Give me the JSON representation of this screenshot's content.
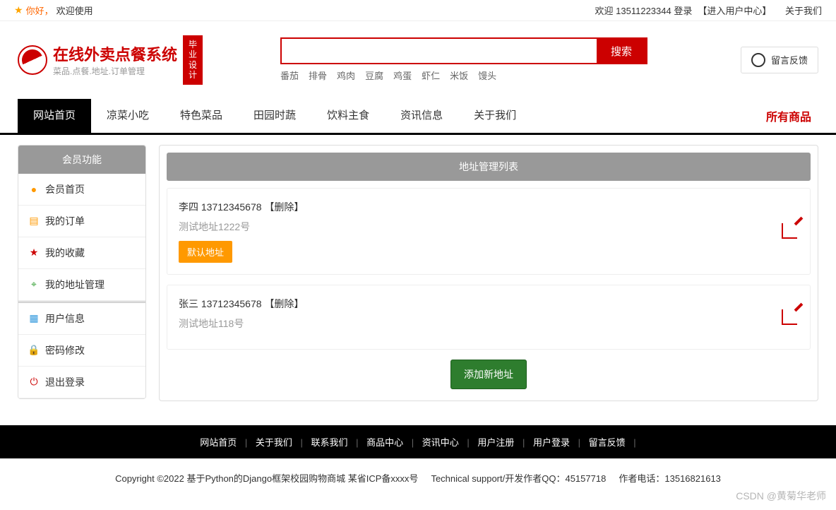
{
  "topbar": {
    "greeting_prefix": "你好，",
    "greeting_text": "欢迎使用",
    "welcome": "欢迎 13511223344 登录 ",
    "user_center": "【进入用户中心】",
    "about": "关于我们"
  },
  "logo": {
    "title": "在线外卖点餐系统",
    "sub": "菜品.点餐.地址.订单管理",
    "badge_line1": "毕业",
    "badge_line2": "设计"
  },
  "search": {
    "button": "搜索",
    "placeholder": "",
    "tags": [
      "番茄",
      "排骨",
      "鸡肉",
      "豆腐",
      "鸡蛋",
      "虾仁",
      "米饭",
      "馒头"
    ]
  },
  "feedback": {
    "label": "留言反馈"
  },
  "nav": {
    "items": [
      "网站首页",
      "凉菜小吃",
      "特色菜品",
      "田园时蔬",
      "饮料主食",
      "资讯信息",
      "关于我们"
    ],
    "all_goods": "所有商品"
  },
  "sidebar": {
    "title": "会员功能",
    "items": [
      {
        "label": "会员首页",
        "icon": "home",
        "cls": "ico-home",
        "glyph": "●"
      },
      {
        "label": "我的订单",
        "icon": "order",
        "cls": "ico-order",
        "glyph": "▤"
      },
      {
        "label": "我的收藏",
        "icon": "star",
        "cls": "ico-star",
        "glyph": "★"
      },
      {
        "label": "我的地址管理",
        "icon": "pin",
        "cls": "ico-pin",
        "glyph": "⌖"
      }
    ],
    "items2": [
      {
        "label": "用户信息",
        "icon": "user",
        "cls": "ico-user",
        "glyph": "▦"
      },
      {
        "label": "密码修改",
        "icon": "lock",
        "cls": "ico-lock",
        "glyph": "🔒"
      },
      {
        "label": "退出登录",
        "icon": "power",
        "cls": "ico-power",
        "glyph": "⏻"
      }
    ]
  },
  "content": {
    "title": "地址管理列表",
    "addresses": [
      {
        "name": "李四",
        "phone": "13712345678",
        "delete": "【删除】",
        "detail": "测试地址1222号",
        "default": true
      },
      {
        "name": "张三",
        "phone": "13712345678",
        "delete": "【删除】",
        "detail": "测试地址118号",
        "default": false
      }
    ],
    "default_label": "默认地址",
    "add_button": "添加新地址"
  },
  "footer": {
    "links": [
      "网站首页",
      "关于我们",
      "联系我们",
      "商品中心",
      "资讯中心",
      "用户注册",
      "用户登录",
      "留言反馈"
    ],
    "copyright": "Copyright ©2022 基于Python的Django框架校园购物商城 某省ICP备xxxx号",
    "support": "Technical support/开发作者QQ：45157718",
    "author": "作者电话：13516821613"
  },
  "watermark": "CSDN @黄菊华老师"
}
